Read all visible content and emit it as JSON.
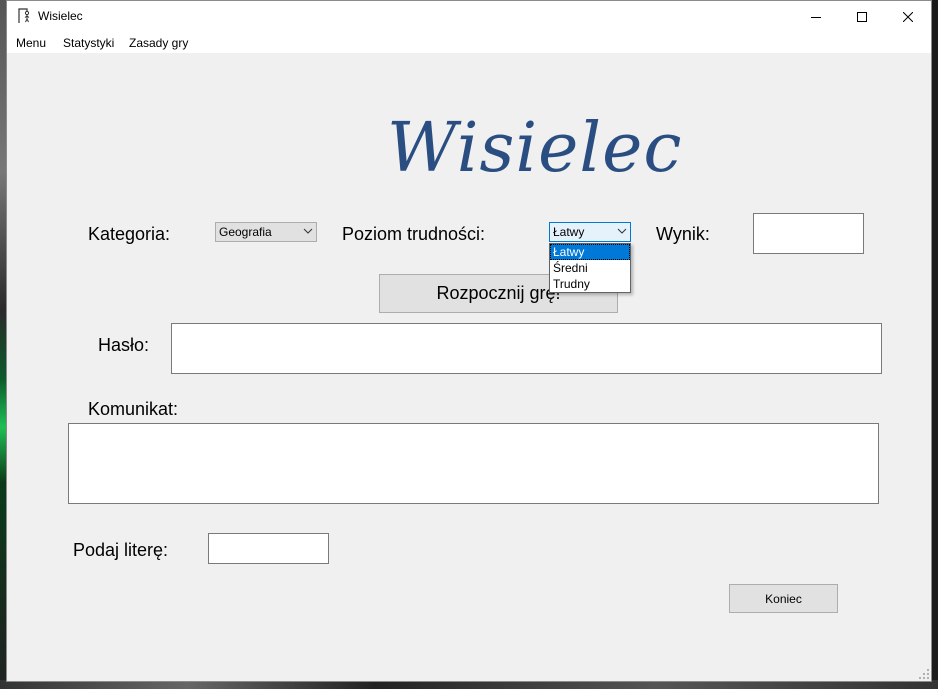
{
  "window": {
    "title": "Wisielec"
  },
  "menu": {
    "items": [
      "Menu",
      "Statystyki",
      "Zasady gry"
    ]
  },
  "logo": "Wisielec",
  "category": {
    "label": "Kategoria:",
    "value": "Geografia"
  },
  "difficulty": {
    "label": "Poziom trudności:",
    "value": "Łatwy",
    "options": [
      "Łatwy",
      "Średni",
      "Trudny"
    ],
    "selected_index": 0
  },
  "score": {
    "label": "Wynik:",
    "value": ""
  },
  "start_button": "Rozpocznij grę!",
  "password": {
    "label": "Hasło:",
    "value": ""
  },
  "message": {
    "label": "Komunikat:",
    "value": ""
  },
  "letter": {
    "label": "Podaj literę:",
    "value": ""
  },
  "end_button": "Koniec",
  "colors": {
    "logo": "#2b4e82",
    "selection": "#0078d7",
    "background": "#f0f0f0"
  }
}
